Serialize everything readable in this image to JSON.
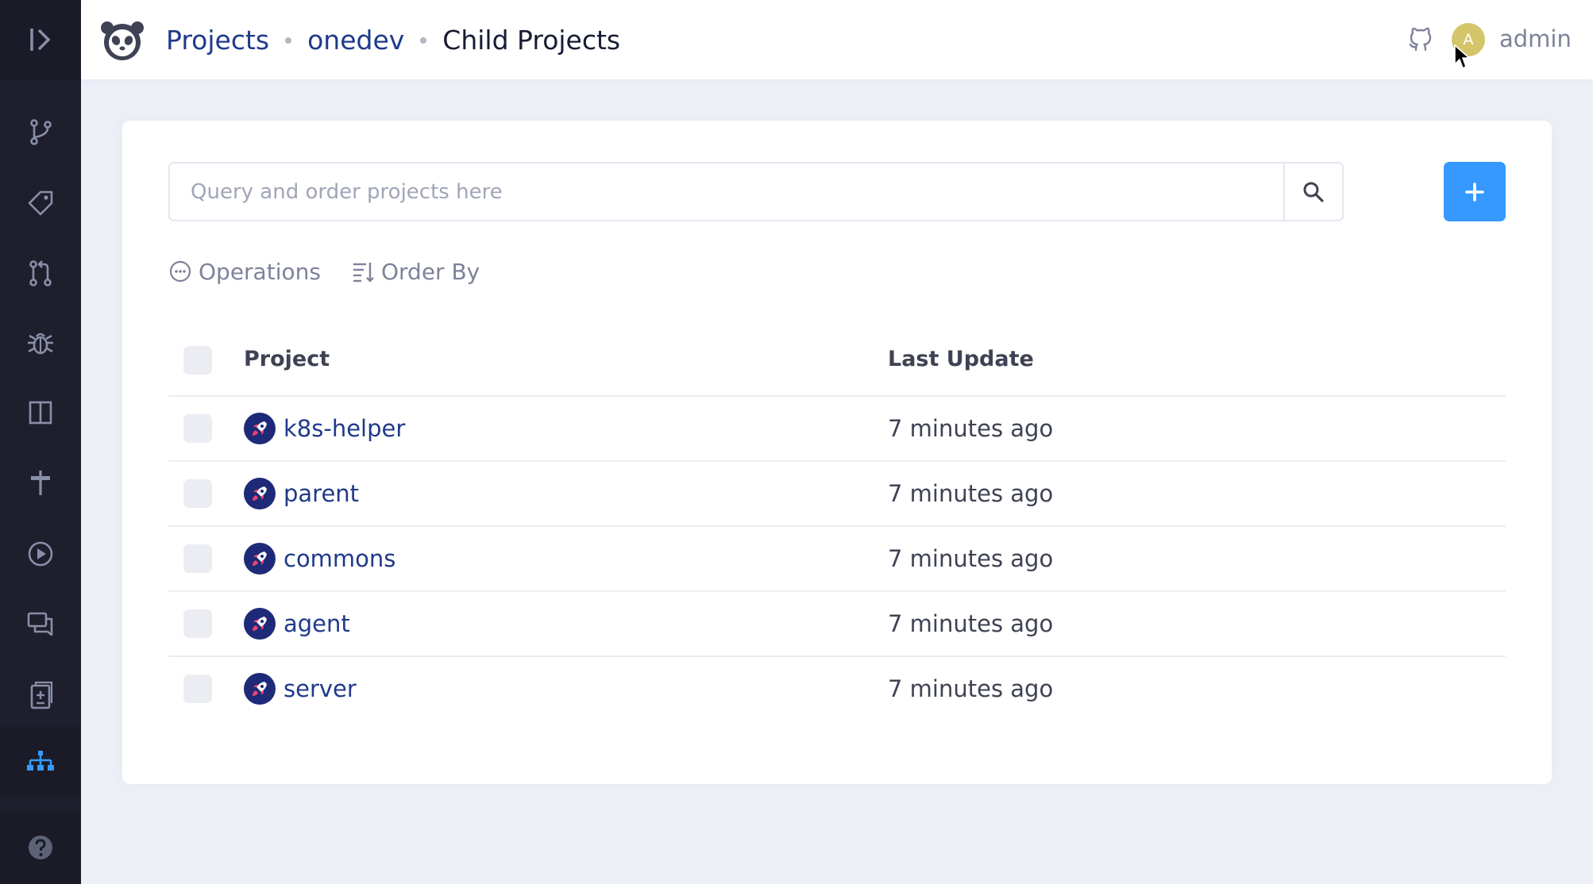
{
  "breadcrumb": {
    "projects": "Projects",
    "parent": "onedev",
    "current": "Child Projects"
  },
  "user": {
    "avatar_initial": "A",
    "name": "admin"
  },
  "search": {
    "placeholder": "Query and order projects here"
  },
  "toolbar": {
    "operations_label": "Operations",
    "order_by_label": "Order By"
  },
  "table": {
    "columns": [
      "Project",
      "Last Update"
    ],
    "rows": [
      {
        "name": "k8s-helper",
        "updated": "7 minutes ago"
      },
      {
        "name": "parent",
        "updated": "7 minutes ago"
      },
      {
        "name": "commons",
        "updated": "7 minutes ago"
      },
      {
        "name": "agent",
        "updated": "7 minutes ago"
      },
      {
        "name": "server",
        "updated": "7 minutes ago"
      }
    ]
  },
  "sidebar": {
    "items": [
      {
        "icon": "branch-icon"
      },
      {
        "icon": "tag-icon"
      },
      {
        "icon": "pull-request-icon"
      },
      {
        "icon": "bug-icon"
      },
      {
        "icon": "board-icon"
      },
      {
        "icon": "signpost-icon"
      },
      {
        "icon": "play-icon"
      },
      {
        "icon": "discussion-icon"
      },
      {
        "icon": "document-plus-icon"
      },
      {
        "icon": "hierarchy-icon",
        "active": true
      }
    ]
  },
  "colors": {
    "accent": "#3699ff",
    "link": "#1f3a8a",
    "sidebar": "#1e1e2d",
    "background": "#eef0f8"
  }
}
